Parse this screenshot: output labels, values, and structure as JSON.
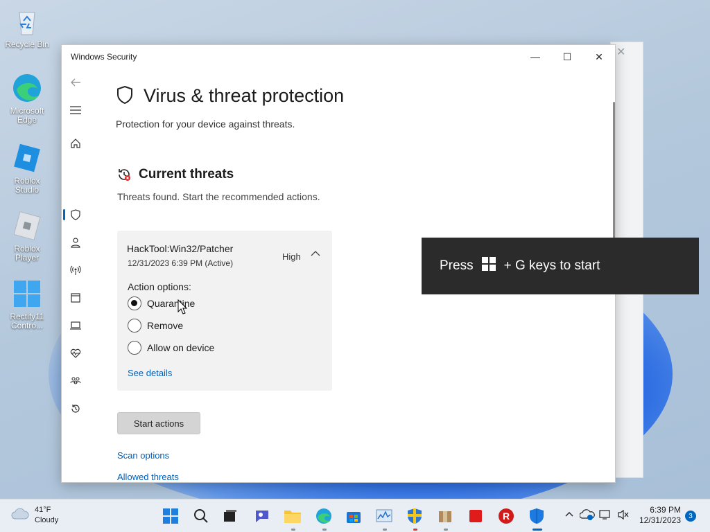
{
  "desktop": {
    "icons": [
      {
        "label": "Recycle Bin"
      },
      {
        "label": "Microsoft Edge"
      },
      {
        "label": "Roblox Studio"
      },
      {
        "label": "Roblox Player"
      },
      {
        "label": "Rectify11 Contro..."
      }
    ]
  },
  "window": {
    "title": "Windows Security",
    "minimize_glyph": "—",
    "maximize_glyph": "☐",
    "close_glyph": "✕"
  },
  "page": {
    "title": "Virus & threat protection",
    "subtitle": "Protection for your device against threats.",
    "section_title": "Current threats",
    "section_subtitle": "Threats found. Start the recommended actions."
  },
  "threat": {
    "name": "HackTool:Win32/Patcher",
    "date": "12/31/2023 6:39 PM (Active)",
    "severity": "High",
    "action_label": "Action options:",
    "options": [
      {
        "label": "Quarantine",
        "selected": true
      },
      {
        "label": "Remove",
        "selected": false
      },
      {
        "label": "Allow on device",
        "selected": false
      }
    ],
    "details_link": "See details"
  },
  "actions": {
    "start_button": "Start actions",
    "scan_options_link": "Scan options",
    "allowed_threats_link": "Allowed threats"
  },
  "toast": {
    "prefix": "Press",
    "suffix": "+ G keys to start"
  },
  "taskbar": {
    "weather_temp": "41°F",
    "weather_desc": "Cloudy",
    "time": "6:39 PM",
    "date": "12/31/2023",
    "notification_count": "3"
  },
  "colors": {
    "accent": "#0067c0",
    "link": "#005fb8"
  }
}
